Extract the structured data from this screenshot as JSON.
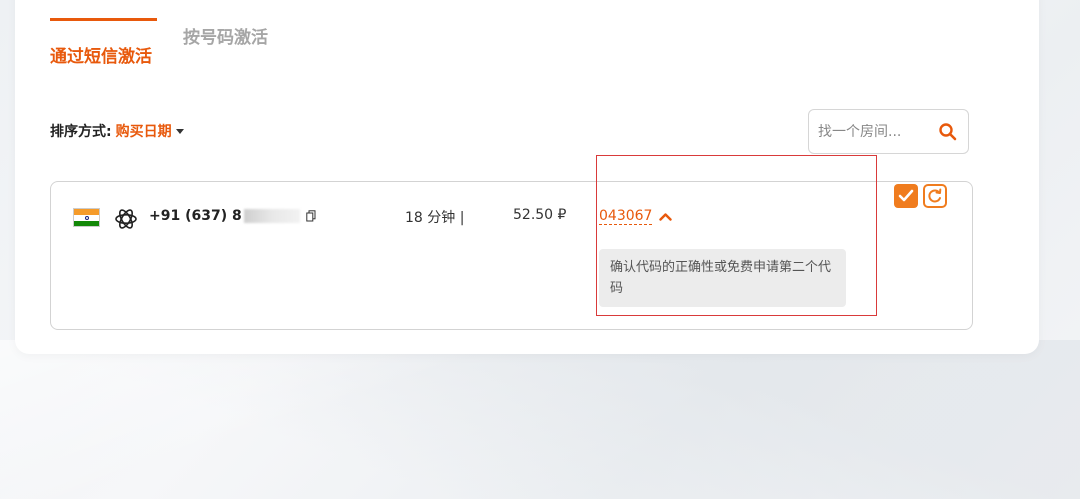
{
  "tabs": [
    {
      "label": "通过短信激活",
      "active": true
    },
    {
      "label": "按号码激活",
      "active": false
    }
  ],
  "sort": {
    "label": "排序方式:",
    "value": "购买日期"
  },
  "search": {
    "placeholder": "找一个房间..."
  },
  "activation": {
    "phone": "+91 (637) 8",
    "time": "18 分钟 |",
    "price": "52.50 ₽",
    "code": "043067",
    "hint": "确认代码的正确性或免费申请第二个代码"
  },
  "colors": {
    "accent": "#e8590c",
    "highlight_border": "#d93a3a"
  },
  "icons": {
    "flag": "india-flag-icon",
    "service": "openai-icon",
    "copy": "copy-icon",
    "search": "search-icon",
    "confirm": "check-icon",
    "refresh": "refresh-icon"
  }
}
